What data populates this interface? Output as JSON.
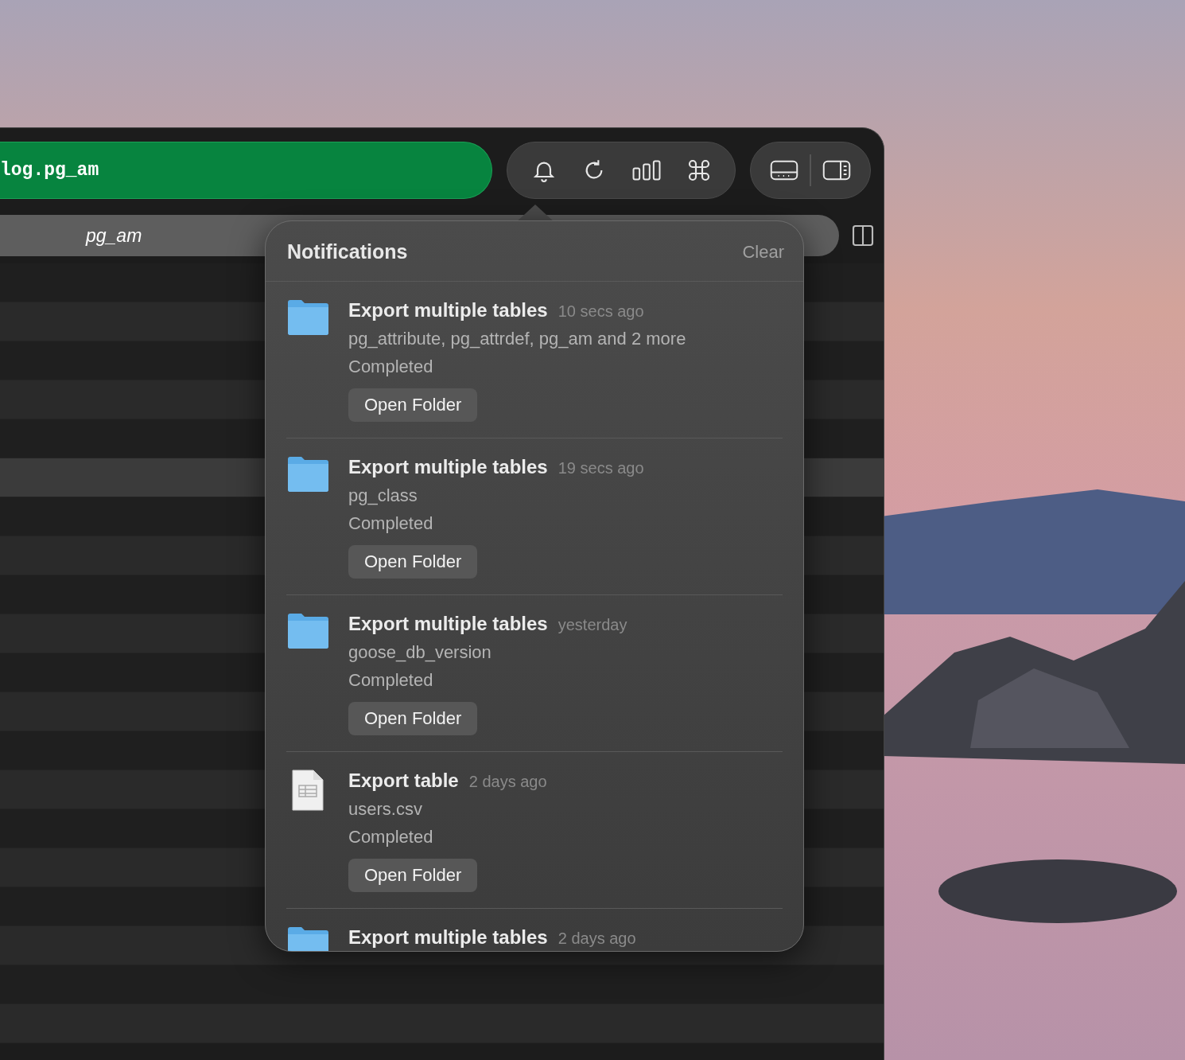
{
  "address_bar": {
    "value": "log.pg_am"
  },
  "tab": {
    "label": "pg_am"
  },
  "table_rows": [
    {
      "selected": false
    },
    {
      "selected": false
    },
    {
      "selected": false
    },
    {
      "selected": false
    },
    {
      "selected": false
    },
    {
      "selected": true
    },
    {
      "selected": false
    },
    {
      "selected": false
    },
    {
      "selected": false
    },
    {
      "selected": false
    },
    {
      "selected": false
    },
    {
      "selected": false
    },
    {
      "selected": false
    },
    {
      "selected": false
    },
    {
      "selected": false
    },
    {
      "selected": false
    },
    {
      "selected": false
    },
    {
      "selected": false
    },
    {
      "selected": false
    },
    {
      "selected": false
    }
  ],
  "notifications": {
    "title": "Notifications",
    "clear": "Clear",
    "items": [
      {
        "kind": "folder",
        "title": "Export multiple tables",
        "time": "10 secs ago",
        "detail": "pg_attribute, pg_attrdef, pg_am and 2 more",
        "status": "Completed",
        "action": "Open Folder"
      },
      {
        "kind": "folder",
        "title": "Export multiple tables",
        "time": "19 secs ago",
        "detail": "pg_class",
        "status": "Completed",
        "action": "Open Folder"
      },
      {
        "kind": "folder",
        "title": "Export multiple tables",
        "time": "yesterday",
        "detail": "goose_db_version",
        "status": "Completed",
        "action": "Open Folder"
      },
      {
        "kind": "file",
        "title": "Export table",
        "time": "2 days ago",
        "detail": "users.csv",
        "status": "Completed",
        "action": "Open Folder"
      },
      {
        "kind": "folder",
        "title": "Export multiple tables",
        "time": "2 days ago"
      }
    ]
  }
}
